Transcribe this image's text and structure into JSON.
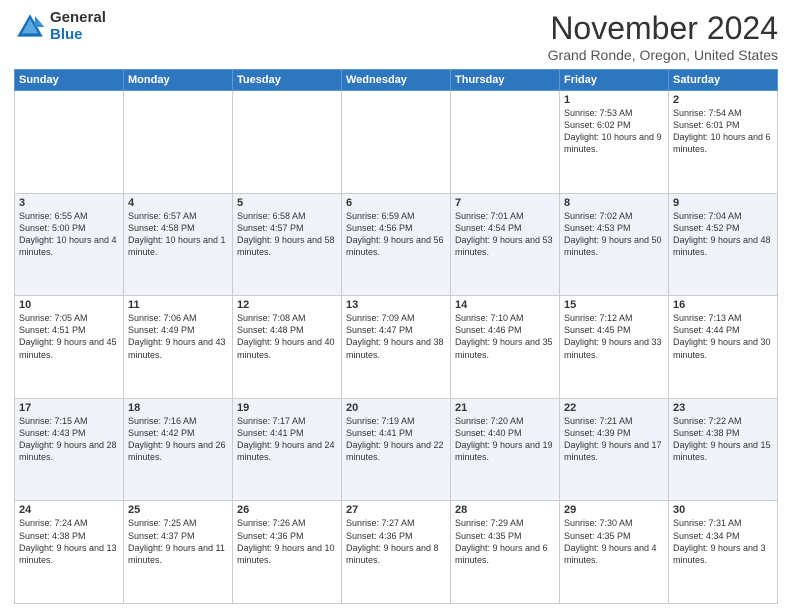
{
  "logo": {
    "general": "General",
    "blue": "Blue"
  },
  "title": "November 2024",
  "location": "Grand Ronde, Oregon, United States",
  "days_of_week": [
    "Sunday",
    "Monday",
    "Tuesday",
    "Wednesday",
    "Thursday",
    "Friday",
    "Saturday"
  ],
  "weeks": [
    [
      {
        "day": "",
        "info": ""
      },
      {
        "day": "",
        "info": ""
      },
      {
        "day": "",
        "info": ""
      },
      {
        "day": "",
        "info": ""
      },
      {
        "day": "",
        "info": ""
      },
      {
        "day": "1",
        "info": "Sunrise: 7:53 AM\nSunset: 6:02 PM\nDaylight: 10 hours and 9 minutes."
      },
      {
        "day": "2",
        "info": "Sunrise: 7:54 AM\nSunset: 6:01 PM\nDaylight: 10 hours and 6 minutes."
      }
    ],
    [
      {
        "day": "3",
        "info": "Sunrise: 6:55 AM\nSunset: 5:00 PM\nDaylight: 10 hours and 4 minutes."
      },
      {
        "day": "4",
        "info": "Sunrise: 6:57 AM\nSunset: 4:58 PM\nDaylight: 10 hours and 1 minute."
      },
      {
        "day": "5",
        "info": "Sunrise: 6:58 AM\nSunset: 4:57 PM\nDaylight: 9 hours and 58 minutes."
      },
      {
        "day": "6",
        "info": "Sunrise: 6:59 AM\nSunset: 4:56 PM\nDaylight: 9 hours and 56 minutes."
      },
      {
        "day": "7",
        "info": "Sunrise: 7:01 AM\nSunset: 4:54 PM\nDaylight: 9 hours and 53 minutes."
      },
      {
        "day": "8",
        "info": "Sunrise: 7:02 AM\nSunset: 4:53 PM\nDaylight: 9 hours and 50 minutes."
      },
      {
        "day": "9",
        "info": "Sunrise: 7:04 AM\nSunset: 4:52 PM\nDaylight: 9 hours and 48 minutes."
      }
    ],
    [
      {
        "day": "10",
        "info": "Sunrise: 7:05 AM\nSunset: 4:51 PM\nDaylight: 9 hours and 45 minutes."
      },
      {
        "day": "11",
        "info": "Sunrise: 7:06 AM\nSunset: 4:49 PM\nDaylight: 9 hours and 43 minutes."
      },
      {
        "day": "12",
        "info": "Sunrise: 7:08 AM\nSunset: 4:48 PM\nDaylight: 9 hours and 40 minutes."
      },
      {
        "day": "13",
        "info": "Sunrise: 7:09 AM\nSunset: 4:47 PM\nDaylight: 9 hours and 38 minutes."
      },
      {
        "day": "14",
        "info": "Sunrise: 7:10 AM\nSunset: 4:46 PM\nDaylight: 9 hours and 35 minutes."
      },
      {
        "day": "15",
        "info": "Sunrise: 7:12 AM\nSunset: 4:45 PM\nDaylight: 9 hours and 33 minutes."
      },
      {
        "day": "16",
        "info": "Sunrise: 7:13 AM\nSunset: 4:44 PM\nDaylight: 9 hours and 30 minutes."
      }
    ],
    [
      {
        "day": "17",
        "info": "Sunrise: 7:15 AM\nSunset: 4:43 PM\nDaylight: 9 hours and 28 minutes."
      },
      {
        "day": "18",
        "info": "Sunrise: 7:16 AM\nSunset: 4:42 PM\nDaylight: 9 hours and 26 minutes."
      },
      {
        "day": "19",
        "info": "Sunrise: 7:17 AM\nSunset: 4:41 PM\nDaylight: 9 hours and 24 minutes."
      },
      {
        "day": "20",
        "info": "Sunrise: 7:19 AM\nSunset: 4:41 PM\nDaylight: 9 hours and 22 minutes."
      },
      {
        "day": "21",
        "info": "Sunrise: 7:20 AM\nSunset: 4:40 PM\nDaylight: 9 hours and 19 minutes."
      },
      {
        "day": "22",
        "info": "Sunrise: 7:21 AM\nSunset: 4:39 PM\nDaylight: 9 hours and 17 minutes."
      },
      {
        "day": "23",
        "info": "Sunrise: 7:22 AM\nSunset: 4:38 PM\nDaylight: 9 hours and 15 minutes."
      }
    ],
    [
      {
        "day": "24",
        "info": "Sunrise: 7:24 AM\nSunset: 4:38 PM\nDaylight: 9 hours and 13 minutes."
      },
      {
        "day": "25",
        "info": "Sunrise: 7:25 AM\nSunset: 4:37 PM\nDaylight: 9 hours and 11 minutes."
      },
      {
        "day": "26",
        "info": "Sunrise: 7:26 AM\nSunset: 4:36 PM\nDaylight: 9 hours and 10 minutes."
      },
      {
        "day": "27",
        "info": "Sunrise: 7:27 AM\nSunset: 4:36 PM\nDaylight: 9 hours and 8 minutes."
      },
      {
        "day": "28",
        "info": "Sunrise: 7:29 AM\nSunset: 4:35 PM\nDaylight: 9 hours and 6 minutes."
      },
      {
        "day": "29",
        "info": "Sunrise: 7:30 AM\nSunset: 4:35 PM\nDaylight: 9 hours and 4 minutes."
      },
      {
        "day": "30",
        "info": "Sunrise: 7:31 AM\nSunset: 4:34 PM\nDaylight: 9 hours and 3 minutes."
      }
    ]
  ]
}
